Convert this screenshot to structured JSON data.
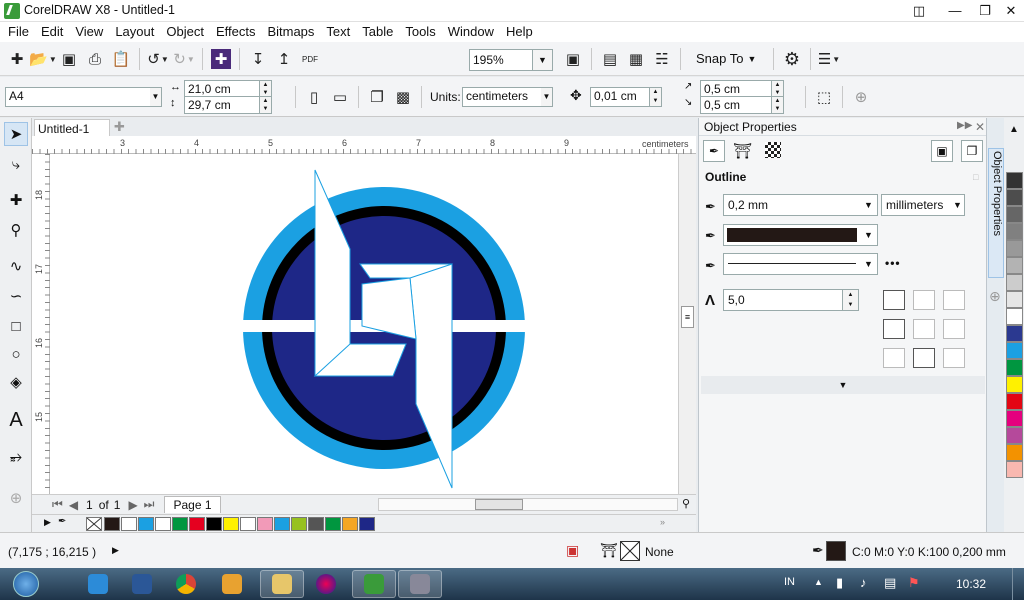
{
  "window": {
    "title": "CorelDRAW X8 - Untitled-1"
  },
  "menu": [
    "File",
    "Edit",
    "View",
    "Layout",
    "Object",
    "Effects",
    "Bitmaps",
    "Text",
    "Table",
    "Tools",
    "Window",
    "Help"
  ],
  "toolbar1": {
    "zoom": "195%",
    "snap_to": "Snap To",
    "pdf_label": "PDF"
  },
  "toolbar2": {
    "page_size": "A4",
    "width": "21,0 cm",
    "height": "29,7 cm",
    "units_label": "Units:",
    "units_value": "centimeters",
    "nudge": "0,01 cm",
    "dup_x": "0,5 cm",
    "dup_y": "0,5 cm"
  },
  "document": {
    "tab": "Untitled-1"
  },
  "ruler": {
    "h_ticks": [
      "3",
      "4",
      "5",
      "6",
      "7",
      "8",
      "9"
    ],
    "h_unit": "centimeters",
    "v_ticks": [
      "18",
      "17",
      "16",
      "15"
    ]
  },
  "pager": {
    "current": "1",
    "of": "of",
    "total": "1",
    "page_tab": "Page 1"
  },
  "docker": {
    "title": "Object Properties",
    "section": "Outline",
    "width_value": "0,2 mm",
    "units_value": "millimeters",
    "miter_value": "5,0",
    "side_tab": "Object Properties",
    "outline_color": "#231815"
  },
  "document_palette": [
    "#231815",
    "#ffffff",
    "#1ba0e2",
    "#ffffff",
    "#00963f",
    "#e5001f",
    "#000000",
    "#fff100",
    "#ffffff",
    "#f29ab8",
    "#1ba0e2",
    "#97c11f",
    "#555555",
    "#00963f",
    "#f5a623",
    "#1e2787"
  ],
  "color_palette": [
    "#333333",
    "#4d4d4d",
    "#666666",
    "#808080",
    "#999999",
    "#b3b3b3",
    "#cccccc",
    "#e6e6e6",
    "#ffffff",
    "#2b3990",
    "#1ba0e2",
    "#009640",
    "#fff100",
    "#e30613",
    "#e5007e",
    "#b5499b",
    "#f39200",
    "#f9b8b0"
  ],
  "status": {
    "coords": "(7,175 ; 16,215 )",
    "fill": "None",
    "outline_desc": "C:0 M:0 Y:0 K:100  0,200 mm"
  },
  "taskbar": {
    "lang": "IN",
    "time": "10:32"
  },
  "colors": {
    "logo_light_blue": "#1ba0e2",
    "logo_navy": "#1e2787",
    "logo_black": "#000000",
    "logo_white": "#ffffff"
  }
}
